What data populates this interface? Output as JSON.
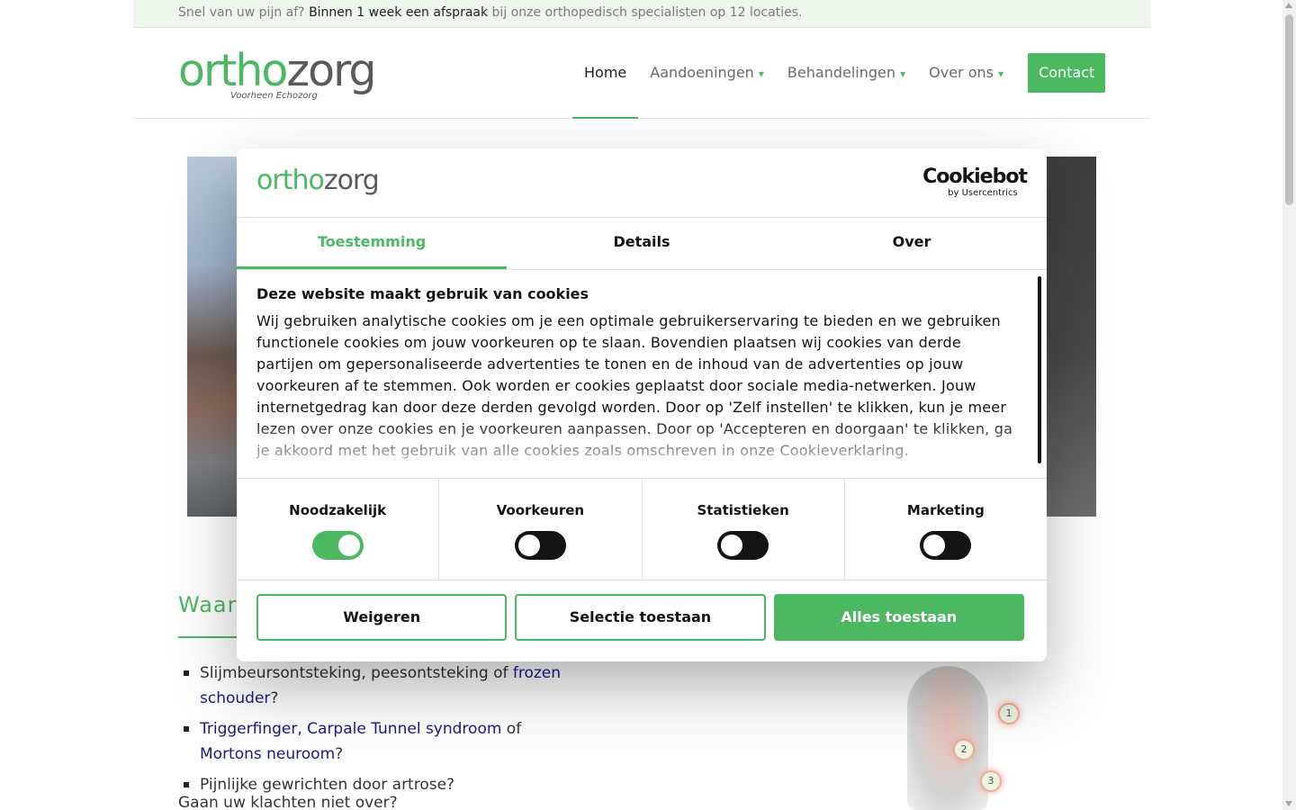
{
  "topbar": {
    "prefix": "Snel van uw pijn af?",
    "bold": "Binnen 1 week een afspraak",
    "suffix": "bij onze orthopedisch specialisten op 12 locaties."
  },
  "logo": {
    "part1": "ortho",
    "part2": "zorg",
    "tagline": "Voorheen Echozorg"
  },
  "nav": {
    "items": [
      {
        "label": "Home",
        "caret": ""
      },
      {
        "label": "Aandoeningen",
        "caret": "▾"
      },
      {
        "label": "Behandelingen",
        "caret": "▾"
      },
      {
        "label": "Over ons",
        "caret": "▾"
      }
    ],
    "contact": "Contact"
  },
  "section": {
    "title": "Waar",
    "bullets": [
      {
        "pre": "Slijmbeursontsteking, peesontsteking of ",
        "link1": "frozen schouder",
        "mid": "",
        "link2": "",
        "post": "?"
      },
      {
        "pre": "",
        "link1": "Triggerfinger, Carpale Tunnel syndroom",
        "mid": " of ",
        "link2": "Mortons neuroom",
        "post": "?"
      },
      {
        "pre": "Pijnlijke gewrichten door artrose?",
        "link1": "",
        "mid": "",
        "link2": "",
        "post": ""
      }
    ],
    "question": "Gaan uw klachten niet over?"
  },
  "figure": {
    "markers": [
      "1",
      "2",
      "3"
    ]
  },
  "dialog": {
    "logo_part1": "ortho",
    "logo_part2": "zorg",
    "brand": "Cookiebot",
    "brand_sub": "by Usercentrics",
    "tabs": [
      "Toestemming",
      "Details",
      "Over"
    ],
    "heading": "Deze website maakt gebruik van cookies",
    "body": "Wij gebruiken analytische cookies om je een optimale gebruikerservaring te bieden en we gebruiken functionele cookies om jouw voorkeuren op te slaan. Bovendien plaatsen wij cookies van derde partijen om gepersonaliseerde advertenties te tonen en de inhoud van de advertenties op jouw voorkeuren af te stemmen. Ook worden er cookies geplaatst door sociale media-netwerken. Jouw internetgedrag kan door deze derden gevolgd worden. Door op 'Zelf instellen' te klikken, kun je meer lezen over onze cookies en je voorkeuren aanpassen. Door op 'Accepteren en doorgaan' te klikken, ga je akkoord met het gebruik van alle cookies zoals omschreven in onze Cookieverklaring.",
    "toggles": [
      {
        "label": "Noodzakelijk",
        "on": true
      },
      {
        "label": "Voorkeuren",
        "on": false
      },
      {
        "label": "Statistieken",
        "on": false
      },
      {
        "label": "Marketing",
        "on": false
      }
    ],
    "buttons": {
      "deny": "Weigeren",
      "selection": "Selectie toestaan",
      "allow_all": "Alles toestaan"
    }
  },
  "colors": {
    "accent": "#4cb861",
    "text": "#141414",
    "link": "#1a1a8c",
    "topbar_bg": "#eaf7e9"
  }
}
